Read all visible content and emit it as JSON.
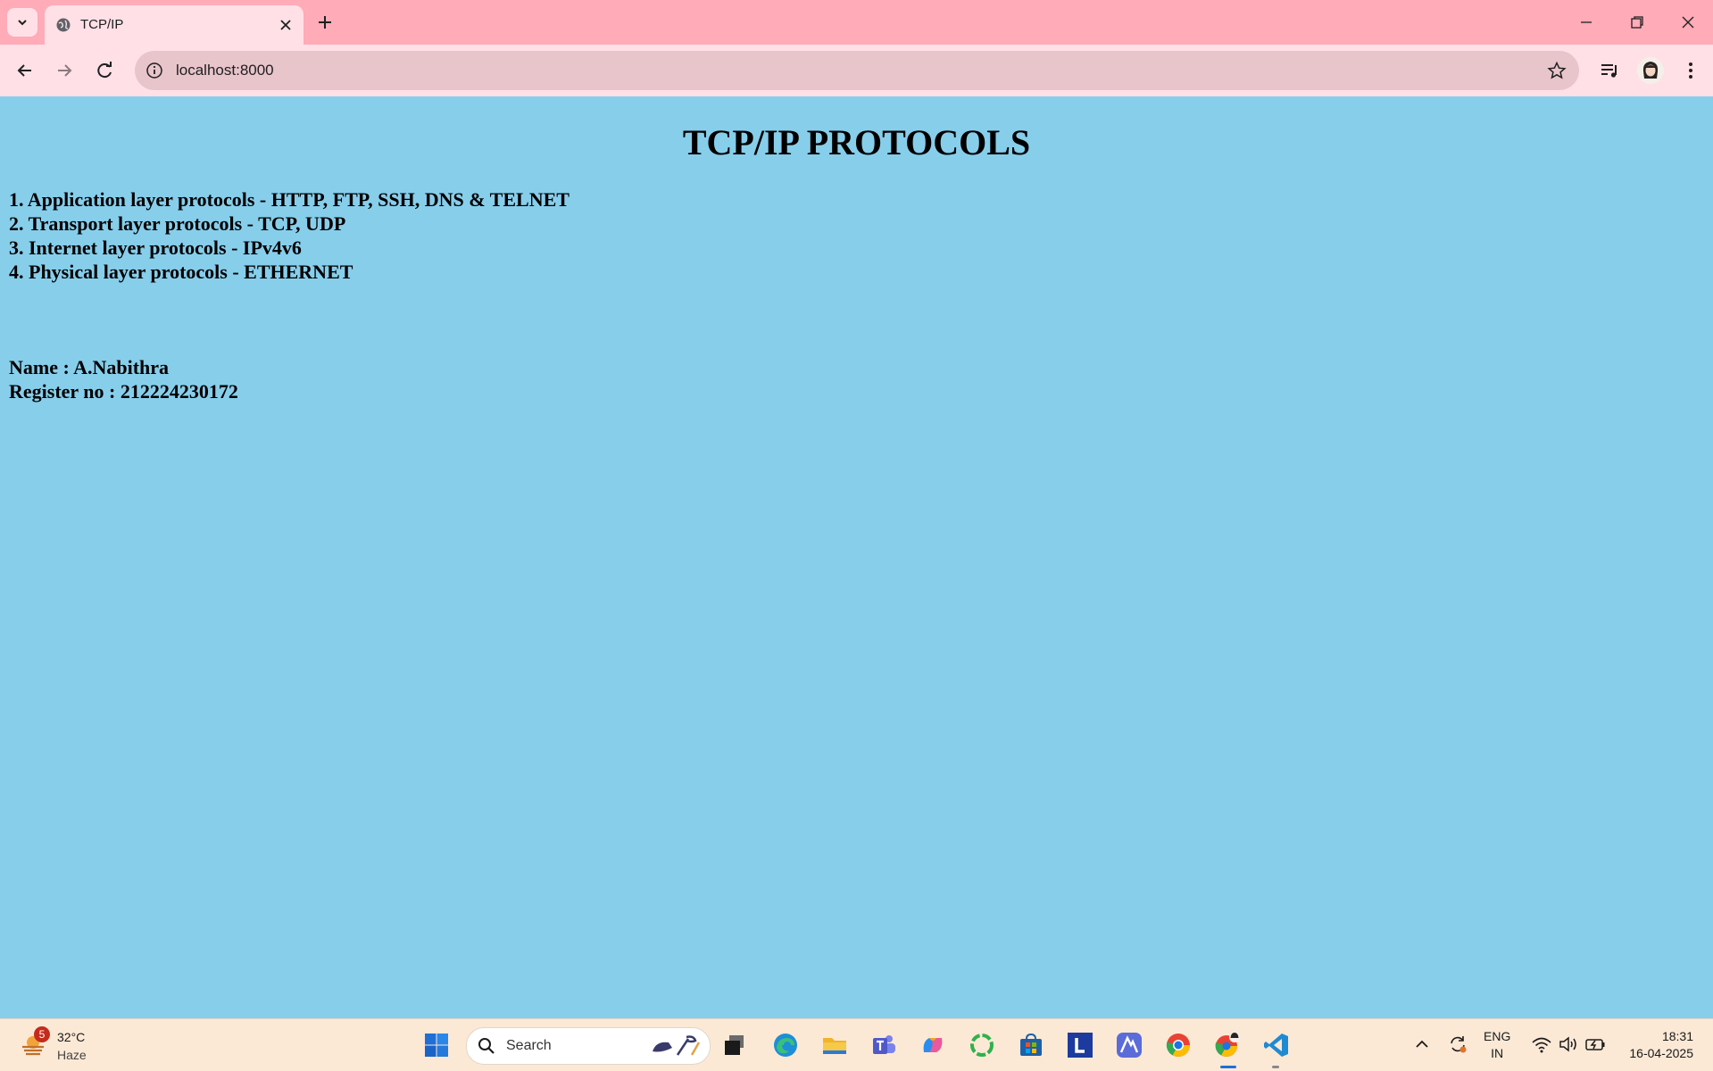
{
  "browser": {
    "tab_title": "TCP/IP",
    "url": "localhost:8000"
  },
  "page": {
    "title": "TCP/IP PROTOCOLS",
    "protocols": [
      "1. Application layer protocols - HTTP, FTP, SSH, DNS & TELNET",
      "2. Transport layer protocols - TCP, UDP",
      "3. Internet layer protocols - IPv4v6",
      "4. Physical layer protocols - ETHERNET"
    ],
    "name_line": "Name : A.Nabithra",
    "register_line": "Register no : 212224230172",
    "background_color": "#87ceeb"
  },
  "taskbar": {
    "weather_badge": "5",
    "temperature": "32°C",
    "condition": "Haze",
    "search_placeholder": "Search",
    "language": "ENG",
    "region": "IN",
    "time": "18:31",
    "date": "16-04-2025"
  },
  "colors": {
    "tab_strip": "#ffabb8",
    "toolbar": "#ffe0e6",
    "omnibox": "#e8c4cb",
    "taskbar": "#fbe9d6"
  }
}
